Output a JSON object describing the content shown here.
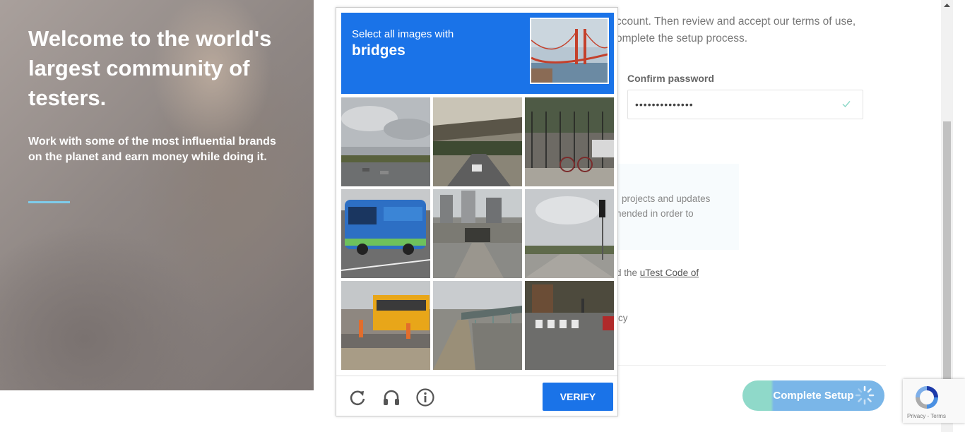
{
  "hero": {
    "title": "Welcome to the world's largest community of testers.",
    "subtitle": "Work with some of the most influential brands on the planet and earn money while doing it."
  },
  "form": {
    "intro_line1": "ccount. Then review and accept our terms of use,",
    "intro_line2": "omplete the setup process.",
    "confirm_password_label": "Confirm password",
    "confirm_password_value": "••••••••••••••",
    "info_line1": "projects and updates",
    "info_line2": "hended in order to",
    "agree_prefix": "d the ",
    "agree_link": "uTest Code of",
    "privacy_fragment": "icy",
    "complete_button": "Complete Setup"
  },
  "captcha": {
    "instruction": "Select all images with",
    "target": "bridges",
    "verify_label": "VERIFY",
    "tiles": [
      "tile-cloudy-highway",
      "tile-overpass-road",
      "tile-sidewalk-bicycle",
      "tile-city-bus",
      "tile-downtown-overpass",
      "tile-traffic-light-road",
      "tile-school-bus",
      "tile-highway-bridge",
      "tile-crosswalk-street"
    ]
  },
  "recaptcha_badge": {
    "links": "Privacy - Terms"
  },
  "colors": {
    "captcha_blue": "#1a73e8",
    "hero_accent": "#7ecbea",
    "setup_button": "#7ab6e8"
  }
}
